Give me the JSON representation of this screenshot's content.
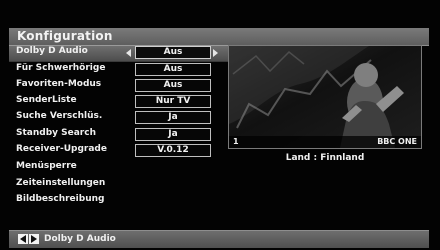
{
  "header": {
    "title": "Konfiguration"
  },
  "menu": {
    "items": [
      {
        "label": "Dolby D Audio",
        "value": "Aus",
        "selected": true
      },
      {
        "label": "Für Schwerhörige",
        "value": "Aus"
      },
      {
        "label": "Favoriten-Modus",
        "value": "Aus"
      },
      {
        "label": "SenderListe",
        "value": "Nur TV"
      },
      {
        "label": "Suche Verschlüs.",
        "value": "Ja"
      },
      {
        "label": "Standby Search",
        "value": "Ja"
      },
      {
        "label": "Receiver-Upgrade",
        "value": "V.0.12"
      },
      {
        "label": "Menüsperre"
      },
      {
        "label": "Zeiteinstellungen"
      },
      {
        "label": "Bildbeschreibung"
      }
    ]
  },
  "preview": {
    "channel_number": "1",
    "channel_name": "BBC ONE",
    "country_label": "Land : Finnland"
  },
  "footer": {
    "left_icon": "left-arrow-key-icon",
    "right_icon": "right-arrow-key-icon",
    "label": "Dolby D Audio"
  }
}
